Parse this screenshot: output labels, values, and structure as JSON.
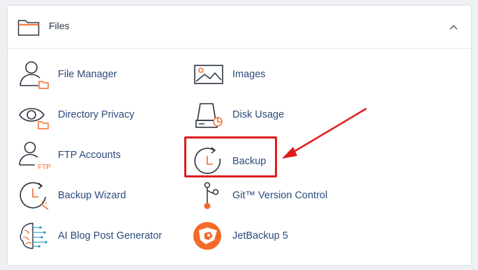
{
  "section": {
    "title": "Files",
    "items": [
      {
        "label": "File Manager",
        "icon": "file-manager-icon"
      },
      {
        "label": "Images",
        "icon": "images-icon"
      },
      {
        "label": "Directory Privacy",
        "icon": "directory-privacy-icon"
      },
      {
        "label": "Disk Usage",
        "icon": "disk-usage-icon"
      },
      {
        "label": "FTP Accounts",
        "icon": "ftp-accounts-icon"
      },
      {
        "label": "Backup",
        "icon": "backup-icon"
      },
      {
        "label": "Backup Wizard",
        "icon": "backup-wizard-icon"
      },
      {
        "label": "Git™ Version Control",
        "icon": "git-version-control-icon"
      },
      {
        "label": "AI Blog Post Generator",
        "icon": "ai-blog-post-generator-icon"
      },
      {
        "label": "JetBackup 5",
        "icon": "jetbackup-icon"
      }
    ]
  },
  "ftp_badge": "FTP",
  "colors": {
    "accent_orange": "#f26b2a",
    "label_blue": "#2b4b7a",
    "annotation_red": "#e01b1b",
    "icon_dark": "#2a3340"
  }
}
